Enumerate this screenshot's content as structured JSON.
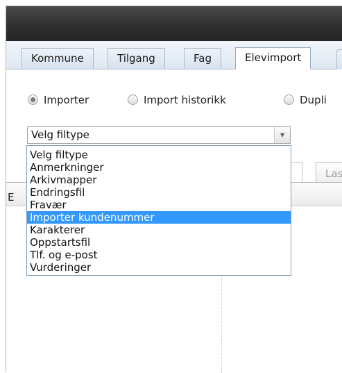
{
  "tabs": [
    {
      "label": "Kommune",
      "active": false
    },
    {
      "label": "Tilgang",
      "active": false
    },
    {
      "label": "Fag",
      "active": false
    },
    {
      "label": "Elevimport",
      "active": true
    }
  ],
  "radio_options": [
    {
      "label": "Importer",
      "checked": true
    },
    {
      "label": "Import historikk",
      "checked": false
    },
    {
      "label": "Dupli",
      "checked": false
    }
  ],
  "select": {
    "value": "Velg filtype",
    "options": [
      "Velg filtype",
      "Anmerkninger",
      "Arkivmapper",
      "Endringsfil",
      "Fravær",
      "Importer kundenummer",
      "Karakterer",
      "Oppstartsfil",
      "Tlf. og e-post",
      "Vurderinger"
    ],
    "highlighted_index": 5
  },
  "load_button": {
    "label": "Las"
  },
  "grid": {
    "header_partial": "E"
  },
  "colors": {
    "highlight": "#3399ff",
    "titlebar": "#2e2e2e"
  }
}
